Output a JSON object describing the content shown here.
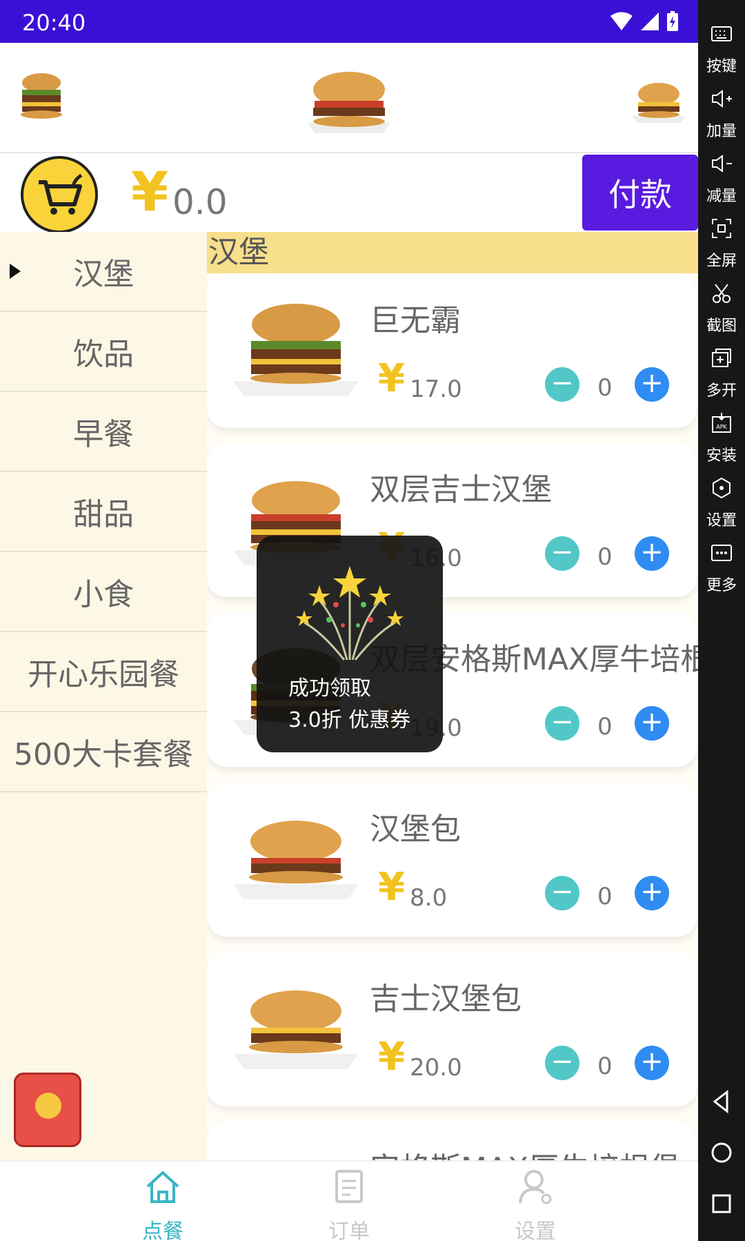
{
  "status": {
    "time": "20:40"
  },
  "cart": {
    "currency": "¥",
    "total": "0.0",
    "pay_label": "付款"
  },
  "categories": [
    {
      "label": "汉堡",
      "selected": true
    },
    {
      "label": "饮品"
    },
    {
      "label": "早餐"
    },
    {
      "label": "甜品"
    },
    {
      "label": "小食"
    },
    {
      "label": "开心乐园餐"
    },
    {
      "label": "500大卡套餐"
    }
  ],
  "section_title": "汉堡",
  "items": [
    {
      "name": "巨无霸",
      "currency": "¥",
      "price": "17.0",
      "qty": "0"
    },
    {
      "name": "双层吉士汉堡",
      "currency": "¥",
      "price": "16.0",
      "qty": "0"
    },
    {
      "name": "双层安格斯MAX厚牛培根堡",
      "currency": "¥",
      "price": "19.0",
      "qty": "0"
    },
    {
      "name": "汉堡包",
      "currency": "¥",
      "price": "8.0",
      "qty": "0"
    },
    {
      "name": "吉士汉堡包",
      "currency": "¥",
      "price": "20.0",
      "qty": "0"
    },
    {
      "name": "安格斯MAX厚牛培根堡",
      "currency": "¥",
      "price": "",
      "qty": ""
    }
  ],
  "toast": {
    "line1": "成功领取",
    "line2": "3.0折 优惠券"
  },
  "bottom_nav": [
    {
      "label": "点餐",
      "active": true
    },
    {
      "label": "订单"
    },
    {
      "label": "设置"
    }
  ],
  "sidebar": {
    "tools": [
      "按键",
      "加量",
      "减量",
      "全屏",
      "截图",
      "多开",
      "安装",
      "设置",
      "更多"
    ]
  },
  "colors": {
    "statusbar": "#3a10d6",
    "pay": "#5a1be0",
    "accent_yellow": "#f2c320",
    "minus": "#52c7c7",
    "plus": "#2f8cf2",
    "nav_active": "#38b6c4"
  }
}
